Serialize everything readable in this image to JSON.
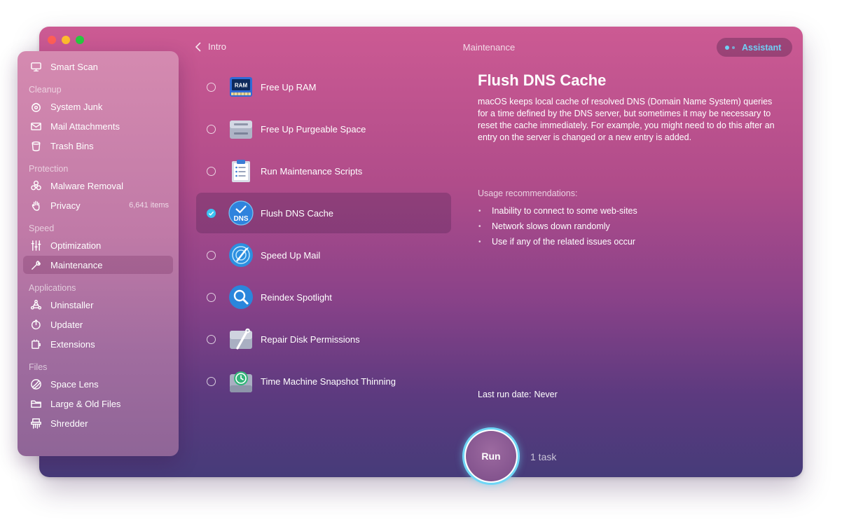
{
  "topbar": {
    "back_label": "Intro",
    "title": "Maintenance",
    "assistant_label": "Assistant"
  },
  "sidebar": {
    "smart_scan": "Smart Scan",
    "sections": {
      "cleanup": "Cleanup",
      "protection": "Protection",
      "speed": "Speed",
      "applications": "Applications",
      "files": "Files"
    },
    "items": {
      "system_junk": "System Junk",
      "mail_attachments": "Mail Attachments",
      "trash_bins": "Trash Bins",
      "malware_removal": "Malware Removal",
      "privacy": "Privacy",
      "privacy_badge": "6,641 items",
      "optimization": "Optimization",
      "maintenance": "Maintenance",
      "uninstaller": "Uninstaller",
      "updater": "Updater",
      "extensions": "Extensions",
      "space_lens": "Space Lens",
      "large_old_files": "Large & Old Files",
      "shredder": "Shredder"
    }
  },
  "tasks": [
    {
      "label": "Free Up RAM",
      "icon": "ram-icon",
      "ram_text": "RAM"
    },
    {
      "label": "Free Up Purgeable Space",
      "icon": "disk-icon"
    },
    {
      "label": "Run Maintenance Scripts",
      "icon": "clipboard-icon"
    },
    {
      "label": "Flush DNS Cache",
      "icon": "dns-icon",
      "dns_text": "DNS",
      "selected": true
    },
    {
      "label": "Speed Up Mail",
      "icon": "mail-speed-icon"
    },
    {
      "label": "Reindex Spotlight",
      "icon": "spotlight-icon"
    },
    {
      "label": "Repair Disk Permissions",
      "icon": "disk-wrench-icon"
    },
    {
      "label": "Time Machine Snapshot Thinning",
      "icon": "time-machine-icon"
    }
  ],
  "detail": {
    "title": "Flush DNS Cache",
    "description": "macOS keeps local cache of resolved DNS (Domain Name System) queries for a time defined by the DNS server, but sometimes it may be necessary to reset the cache immediately. For example, you might need to do this after an entry on the server is changed or a new entry is added.",
    "usage_heading": "Usage recommendations:",
    "usage": [
      "Inability to connect to some web-sites",
      "Network slows down randomly",
      "Use if any of the related issues occur"
    ],
    "last_run_label": "Last run date:",
    "last_run_value": "Never"
  },
  "footer": {
    "run_label": "Run",
    "task_count": "1 task"
  },
  "colors": {
    "accent": "#6fd0f5",
    "check": "#3bc3f2"
  }
}
